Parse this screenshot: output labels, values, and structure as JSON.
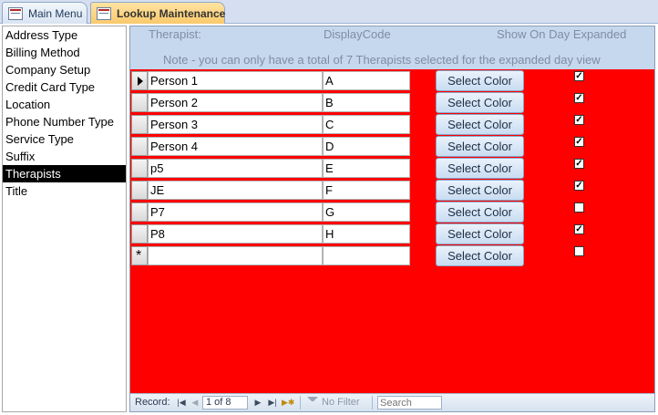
{
  "tabs": [
    {
      "label": "Main Menu",
      "active": false
    },
    {
      "label": "Lookup Maintenance",
      "active": true
    }
  ],
  "lookup_list": {
    "items": [
      "Address Type",
      "Billing Method",
      "Company Setup",
      "Credit Card Type",
      "Location",
      "Phone Number Type",
      "Service Type",
      "Suffix",
      "Therapists",
      "Title"
    ],
    "selected": "Therapists"
  },
  "form": {
    "header": {
      "therapist": "Therapist:",
      "display_code": "DisplayCode",
      "show_on_day": "Show On Day Expanded",
      "note": "Note - you can only have a total of 7 Therapists selected for the expanded day view"
    },
    "button_label": "Select Color",
    "rows": [
      {
        "name": "Person 1",
        "code": "A",
        "show": true
      },
      {
        "name": "Person 2",
        "code": "B",
        "show": true
      },
      {
        "name": "Person 3",
        "code": "C",
        "show": true
      },
      {
        "name": "Person 4",
        "code": "D",
        "show": true
      },
      {
        "name": "p5",
        "code": "E",
        "show": true
      },
      {
        "name": "JE",
        "code": "F",
        "show": true
      },
      {
        "name": "P7",
        "code": "G",
        "show": false
      },
      {
        "name": "P8",
        "code": "H",
        "show": true
      },
      {
        "name": "",
        "code": "",
        "show": false
      }
    ],
    "background_color": "#ff0000"
  },
  "navbar": {
    "record_label": "Record:",
    "current": "1 of 8",
    "filter_label": "No Filter",
    "search_placeholder": "Search"
  }
}
